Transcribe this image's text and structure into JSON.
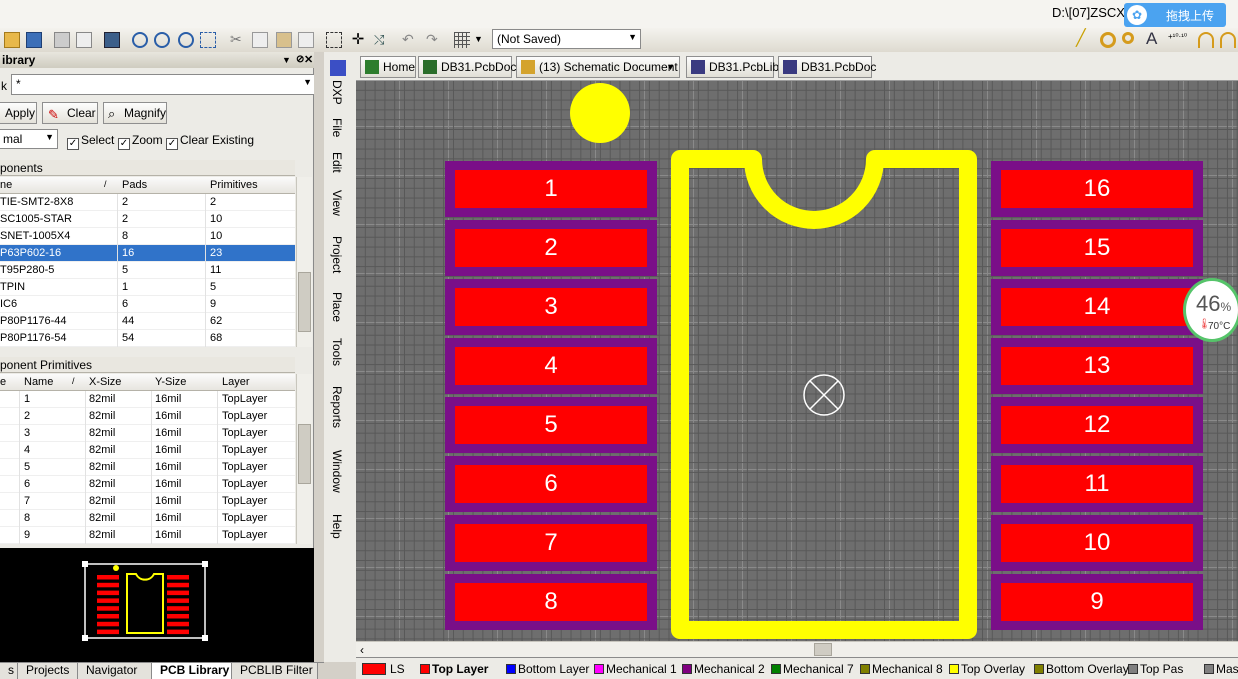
{
  "window": {
    "title_path": "D:\\[07]ZSCX",
    "upload_badge": "拖拽上传"
  },
  "toolbar": {
    "save_state": "(Not Saved)"
  },
  "panel": {
    "title": "ibrary",
    "filter_label": "k",
    "filter_value": "*",
    "apply_label": "Apply",
    "clear_label": "Clear",
    "magnify_label": "Magnify",
    "mode_value": "mal",
    "select_label": "Select",
    "zoom_label": "Zoom",
    "clear_existing_label": "Clear Existing",
    "components_header": "ponents",
    "components_columns": [
      "ne",
      "Pads",
      "Primitives"
    ],
    "components": [
      {
        "name": "TIE-SMT2-8X8",
        "pads": "2",
        "prims": "2"
      },
      {
        "name": "SC1005-STAR",
        "pads": "2",
        "prims": "10"
      },
      {
        "name": "SNET-1005X4",
        "pads": "8",
        "prims": "10"
      },
      {
        "name": "P63P602-16",
        "pads": "16",
        "prims": "23"
      },
      {
        "name": "T95P280-5",
        "pads": "5",
        "prims": "11"
      },
      {
        "name": "TPIN",
        "pads": "1",
        "prims": "5"
      },
      {
        "name": "IC6",
        "pads": "6",
        "prims": "9"
      },
      {
        "name": "P80P1176-44",
        "pads": "44",
        "prims": "62"
      },
      {
        "name": "P80P1176-54",
        "pads": "54",
        "prims": "68"
      }
    ],
    "selected_component_index": 3,
    "primitives_header": "ponent Primitives",
    "primitives_columns": [
      "e",
      "Name",
      "X-Size",
      "Y-Size",
      "Layer"
    ],
    "primitives": [
      {
        "name": "1",
        "x": "82mil",
        "y": "16mil",
        "layer": "TopLayer"
      },
      {
        "name": "2",
        "x": "82mil",
        "y": "16mil",
        "layer": "TopLayer"
      },
      {
        "name": "3",
        "x": "82mil",
        "y": "16mil",
        "layer": "TopLayer"
      },
      {
        "name": "4",
        "x": "82mil",
        "y": "16mil",
        "layer": "TopLayer"
      },
      {
        "name": "5",
        "x": "82mil",
        "y": "16mil",
        "layer": "TopLayer"
      },
      {
        "name": "6",
        "x": "82mil",
        "y": "16mil",
        "layer": "TopLayer"
      },
      {
        "name": "7",
        "x": "82mil",
        "y": "16mil",
        "layer": "TopLayer"
      },
      {
        "name": "8",
        "x": "82mil",
        "y": "16mil",
        "layer": "TopLayer"
      },
      {
        "name": "9",
        "x": "82mil",
        "y": "16mil",
        "layer": "TopLayer"
      }
    ]
  },
  "bottom_tabs": [
    {
      "label": "s",
      "active": false
    },
    {
      "label": "Projects",
      "active": false
    },
    {
      "label": "Navigator",
      "active": false
    },
    {
      "label": "PCB Library",
      "active": true
    },
    {
      "label": "PCBLIB Filter",
      "active": false
    }
  ],
  "vertical_menu": [
    "DXP",
    "File",
    "Edit",
    "View",
    "Project",
    "Place",
    "Tools",
    "Reports",
    "Window",
    "Help"
  ],
  "doc_tabs": [
    {
      "label": "Home",
      "icon": "home-icon"
    },
    {
      "label": "DB31.PcbDoc",
      "icon": "pcb-icon"
    },
    {
      "label": "(13) Schematic Document",
      "icon": "folder-icon"
    },
    {
      "label": "DB31.PcbLib",
      "icon": "pcblib-icon"
    },
    {
      "label": "DB31.PcbDoc",
      "icon": "pcbdoc-icon"
    }
  ],
  "pads_left": [
    "1",
    "2",
    "3",
    "4",
    "5",
    "6",
    "7",
    "8"
  ],
  "pads_right": [
    "16",
    "15",
    "14",
    "13",
    "12",
    "11",
    "10",
    "9"
  ],
  "cpu_widget": {
    "percent": "46",
    "unit": "%",
    "temp": "70°C"
  },
  "layer_tabs": [
    {
      "label": "LS",
      "color": "#ff0000"
    },
    {
      "label": "Top Layer",
      "color": "#ff0000",
      "bold": true
    },
    {
      "label": "Bottom Layer",
      "color": "#0000ff"
    },
    {
      "label": "Mechanical 1",
      "color": "#ff00ff"
    },
    {
      "label": "Mechanical 2",
      "color": "#800080"
    },
    {
      "label": "Mechanical 7",
      "color": "#008000"
    },
    {
      "label": "Mechanical 8",
      "color": "#808000"
    },
    {
      "label": "Top Overlay",
      "color": "#ffff00"
    },
    {
      "label": "Bottom Overlay",
      "color": "#808000"
    },
    {
      "label": "Top Pas",
      "color": "#808080"
    },
    {
      "label": "Mask",
      "color": "#808080"
    }
  ],
  "colors": {
    "pad": "#ff0000",
    "solder_mask": "#7a0f88",
    "overlay": "#ffff00",
    "selection": "#3073c9"
  }
}
